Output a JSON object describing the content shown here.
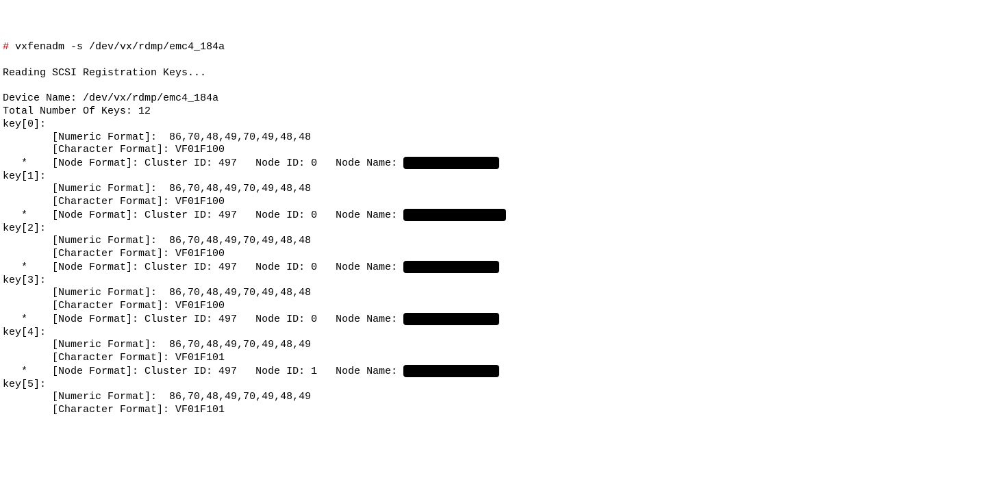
{
  "command": {
    "prompt": "#",
    "text": "vxfenadm -s /dev/vx/rdmp/emc4_184a"
  },
  "header": {
    "reading": "Reading SCSI Registration Keys...",
    "device_label": "Device Name:",
    "device_value": "/dev/vx/rdmp/emc4_184a",
    "total_label": "Total Number Of Keys:",
    "total_value": "12"
  },
  "keys": [
    {
      "label": "key[0]:",
      "numeric": "[Numeric Format]:  86,70,48,49,70,49,48,48",
      "char": "[Character Format]: VF01F100",
      "node": "[Node Format]: Cluster ID: 497   Node ID: 0   Node Name: ",
      "show_node": true
    },
    {
      "label": "key[1]:",
      "numeric": "[Numeric Format]:  86,70,48,49,70,49,48,48",
      "char": "[Character Format]: VF01F100",
      "node": "[Node Format]: Cluster ID: 497   Node ID: 0   Node Name: ",
      "show_node": true
    },
    {
      "label": "key[2]:",
      "numeric": "[Numeric Format]:  86,70,48,49,70,49,48,48",
      "char": "[Character Format]: VF01F100",
      "node": "[Node Format]: Cluster ID: 497   Node ID: 0   Node Name: ",
      "show_node": true
    },
    {
      "label": "key[3]:",
      "numeric": "[Numeric Format]:  86,70,48,49,70,49,48,48",
      "char": "[Character Format]: VF01F100",
      "node": "[Node Format]: Cluster ID: 497   Node ID: 0   Node Name: ",
      "show_node": true
    },
    {
      "label": "key[4]:",
      "numeric": "[Numeric Format]:  86,70,48,49,70,49,48,49",
      "char": "[Character Format]: VF01F101",
      "node": "[Node Format]: Cluster ID: 497   Node ID: 1   Node Name: ",
      "show_node": true
    },
    {
      "label": "key[5]:",
      "numeric": "[Numeric Format]:  86,70,48,49,70,49,48,49",
      "char": "[Character Format]: VF01F101",
      "node": "",
      "show_node": false
    }
  ]
}
